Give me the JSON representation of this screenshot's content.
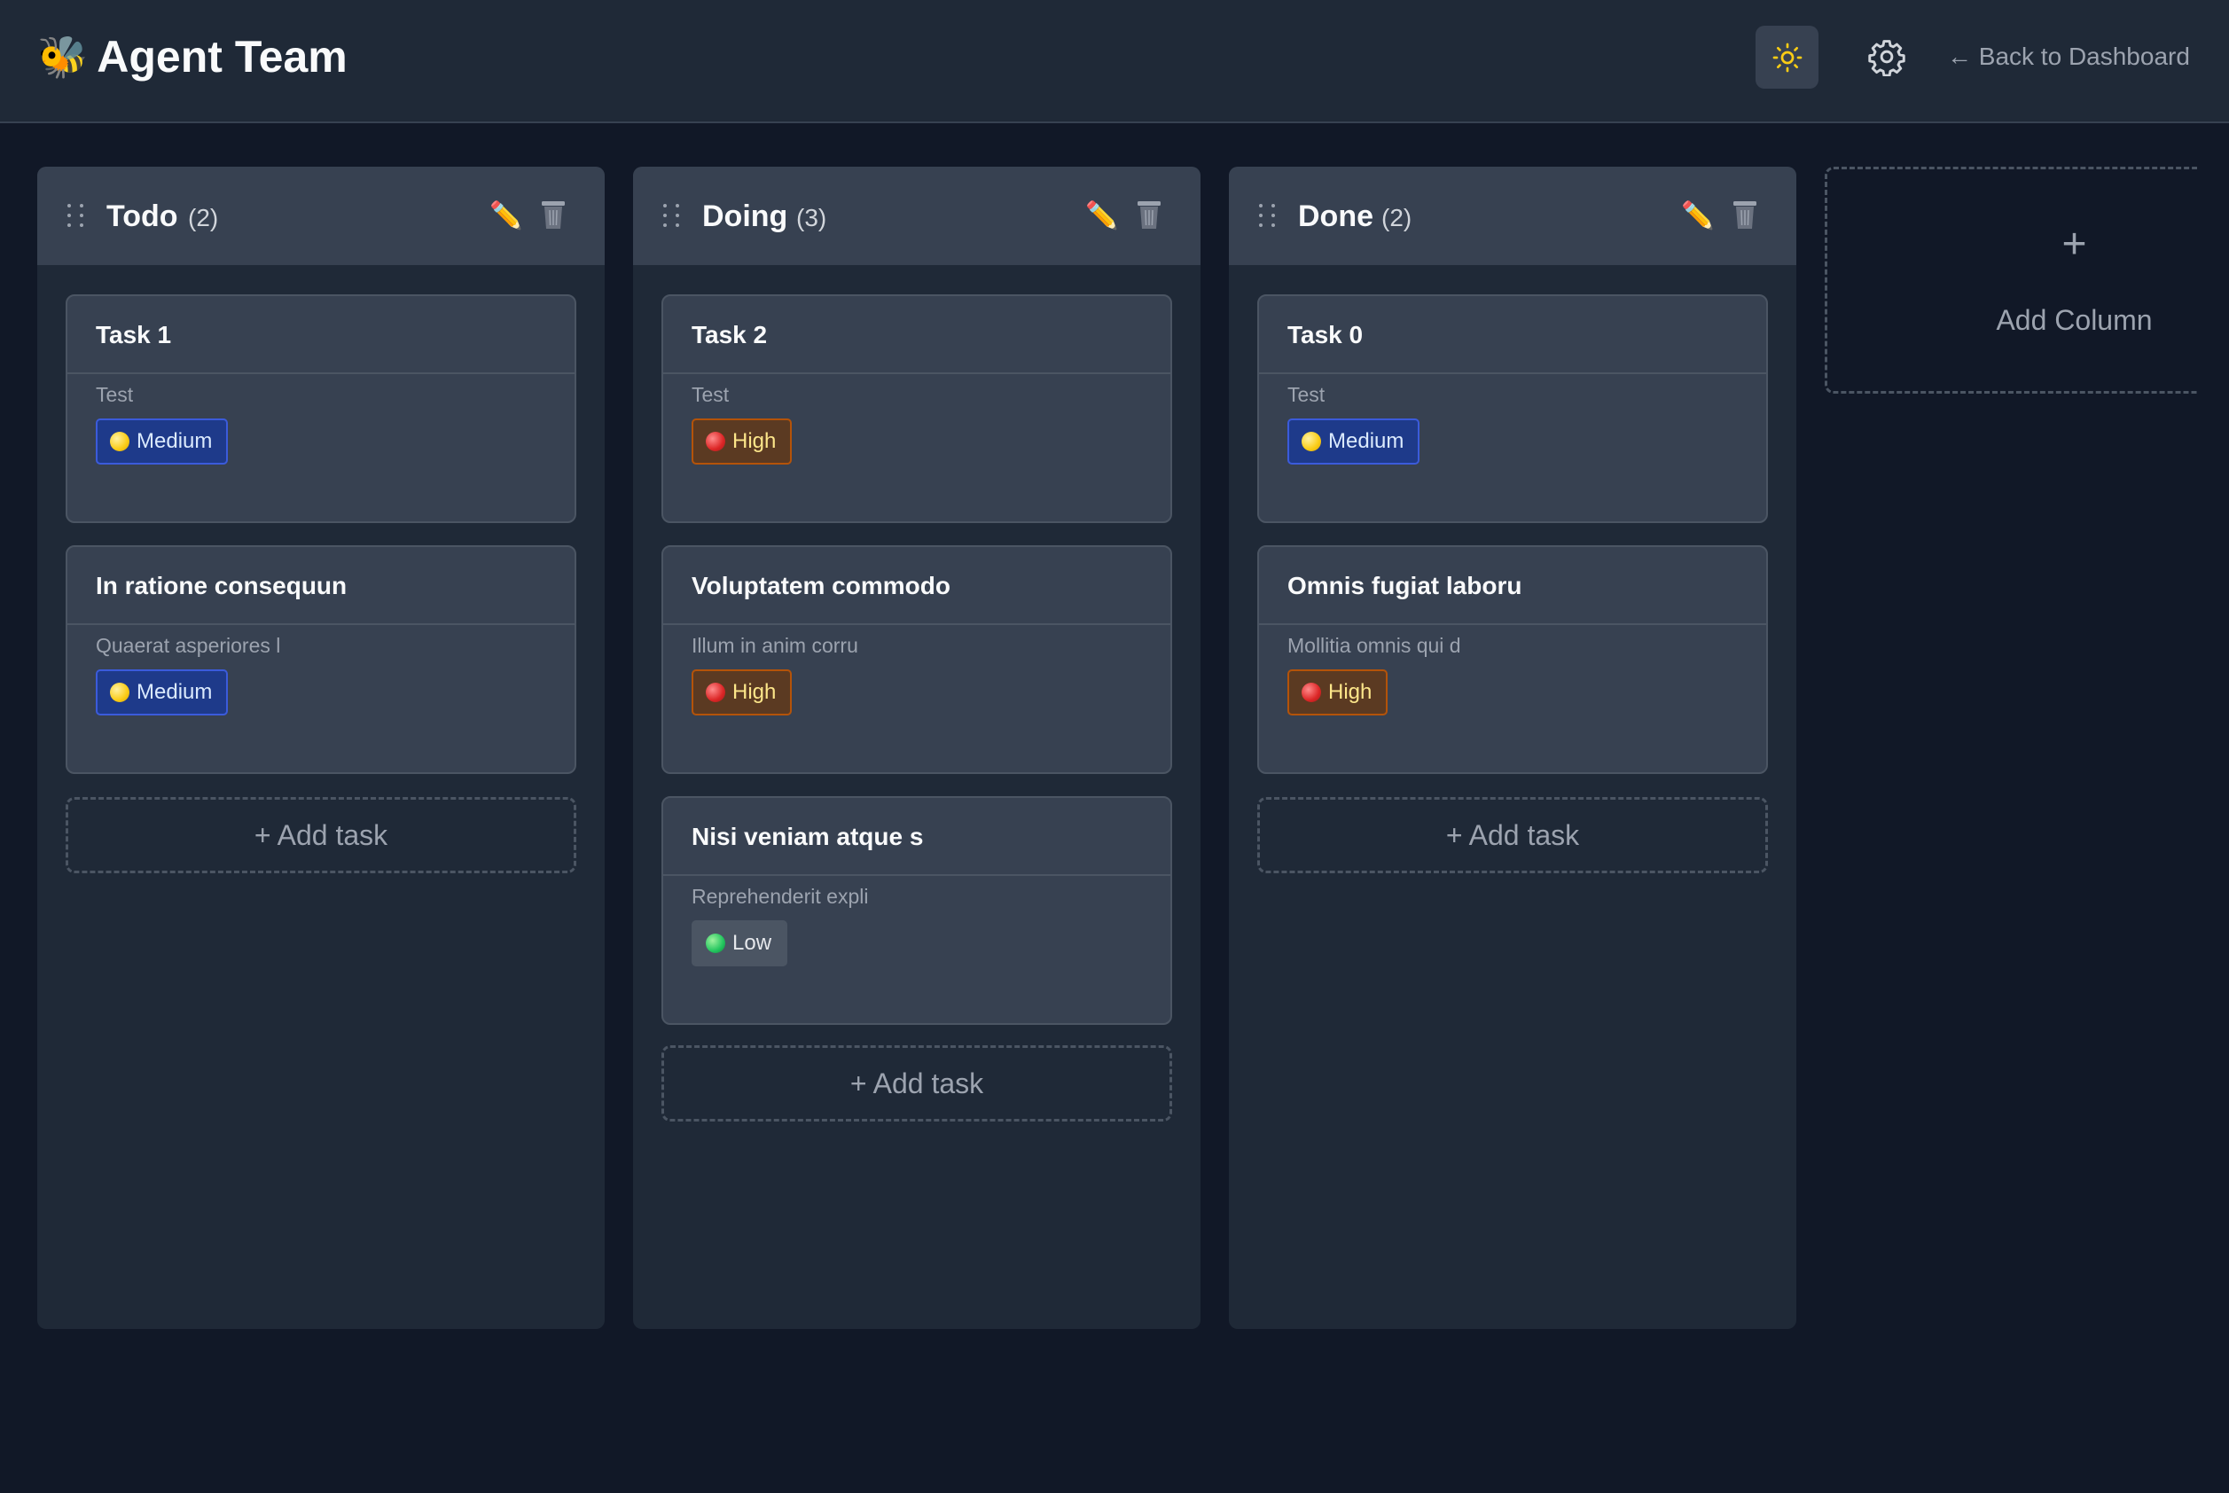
{
  "header": {
    "logo_icon": "bee-emoji",
    "logo_glyph": "🐝",
    "title": "Agent Team",
    "theme_icon": "sun-icon",
    "settings_icon": "gear-icon",
    "back_label": "← Back to Dashboard"
  },
  "columns": [
    {
      "title": "Todo",
      "count": "(2)",
      "cards": [
        {
          "title": "Task 1",
          "desc": "Test",
          "priority": "Medium"
        },
        {
          "title": "In ratione consequun",
          "desc": "Quaerat asperiores l",
          "priority": "Medium"
        }
      ],
      "add_task_label": "+ Add task"
    },
    {
      "title": "Doing",
      "count": "(3)",
      "cards": [
        {
          "title": "Task 2",
          "desc": "Test",
          "priority": "High"
        },
        {
          "title": "Voluptatem commodo",
          "desc": "Illum in anim corru",
          "priority": "High"
        },
        {
          "title": "Nisi veniam atque s",
          "desc": "Reprehenderit expli",
          "priority": "Low"
        }
      ],
      "add_task_label": "+ Add task"
    },
    {
      "title": "Done",
      "count": "(2)",
      "cards": [
        {
          "title": "Task 0",
          "desc": "Test",
          "priority": "Medium"
        },
        {
          "title": "Omnis fugiat laboru",
          "desc": "Mollitia omnis qui d",
          "priority": "High"
        }
      ],
      "add_task_label": "+ Add task"
    }
  ],
  "add_column": {
    "plus": "+",
    "label": "Add Column"
  },
  "colors": {
    "background": "#111827",
    "column": "#1f2937",
    "card": "#374151",
    "medium": "#1e3a8a",
    "high": "#5b3a22",
    "low": "#4b5563",
    "sun": "#facc15"
  }
}
